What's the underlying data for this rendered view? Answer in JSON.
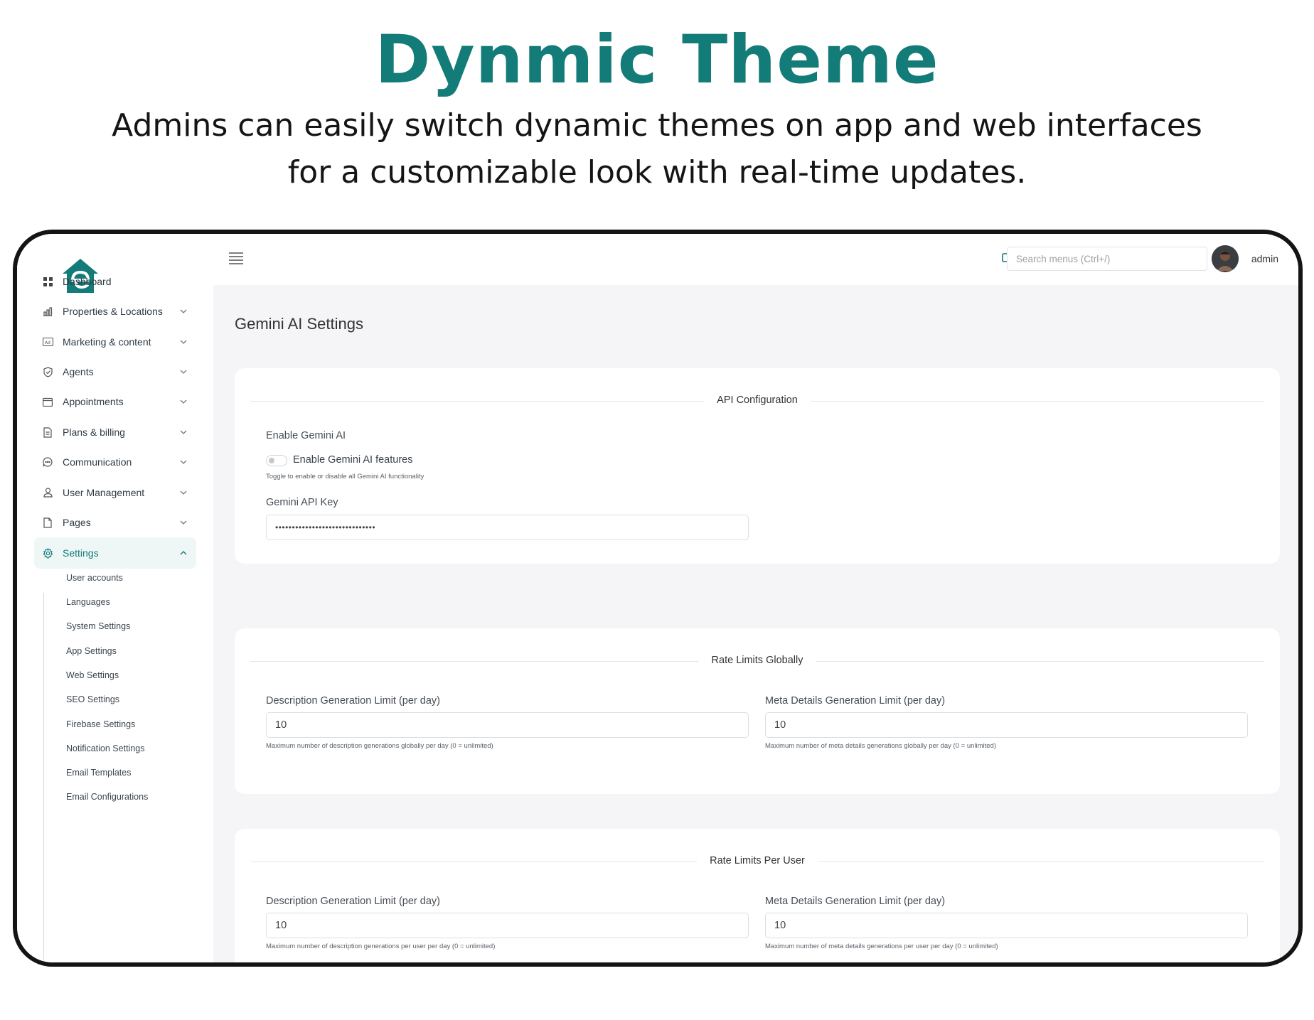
{
  "hero": {
    "title": "Dynmic Theme",
    "subtitle_line1": "Admins can easily switch dynamic themes on app and web interfaces",
    "subtitle_line2": "for a customizable look with real-time updates."
  },
  "brand": {
    "accent": "#137b78",
    "logo_icon": "house-e-logo"
  },
  "sidebar": {
    "items": [
      {
        "label": "Dashboard",
        "icon": "grid-icon",
        "expandable": false
      },
      {
        "label": "Properties & Locations",
        "icon": "building-chart-icon",
        "expandable": true
      },
      {
        "label": "Marketing & content",
        "icon": "ad-icon",
        "expandable": true
      },
      {
        "label": "Agents",
        "icon": "shield-icon",
        "expandable": true
      },
      {
        "label": "Appointments",
        "icon": "calendar-icon",
        "expandable": true
      },
      {
        "label": "Plans & billing",
        "icon": "document-icon",
        "expandable": true
      },
      {
        "label": "Communication",
        "icon": "chat-icon",
        "expandable": true
      },
      {
        "label": "User Management",
        "icon": "user-icon",
        "expandable": true
      },
      {
        "label": "Pages",
        "icon": "page-icon",
        "expandable": true
      },
      {
        "label": "Settings",
        "icon": "gear-icon",
        "expandable": true,
        "active": true
      }
    ],
    "settings_children": [
      "User accounts",
      "Languages",
      "System Settings",
      "App Settings",
      "Web Settings",
      "SEO Settings",
      "Firebase Settings",
      "Notification Settings",
      "Email Templates",
      "Email Configurations"
    ]
  },
  "topbar": {
    "search_placeholder": "Search menus (Ctrl+/)",
    "username": "admin"
  },
  "page": {
    "title": "Gemini AI Settings",
    "api_config": {
      "heading": "API Configuration",
      "enable_label": "Enable Gemini AI",
      "toggle_label": "Enable Gemini AI features",
      "toggle_on": false,
      "toggle_help": "Toggle to enable or disable all Gemini AI functionality",
      "api_key_label": "Gemini API Key",
      "api_key_value": "••••••••••••••••••••••••••••••"
    },
    "global_limits": {
      "heading": "Rate Limits Globally",
      "desc_label": "Description Generation Limit (per day)",
      "desc_value": "10",
      "desc_help": "Maximum number of description generations globally per day (0 = unlimited)",
      "meta_label": "Meta Details Generation Limit (per day)",
      "meta_value": "10",
      "meta_help": "Maximum number of meta details generations globally per day (0 = unlimited)"
    },
    "user_limits": {
      "heading": "Rate Limits Per User",
      "desc_label": "Description Generation Limit (per day)",
      "desc_value": "10",
      "desc_help": "Maximum number of description generations per user per day (0 = unlimited)",
      "meta_label": "Meta Details Generation Limit (per day)",
      "meta_value": "10",
      "meta_help": "Maximum number of meta details generations per user per day (0 = unlimited)"
    }
  }
}
